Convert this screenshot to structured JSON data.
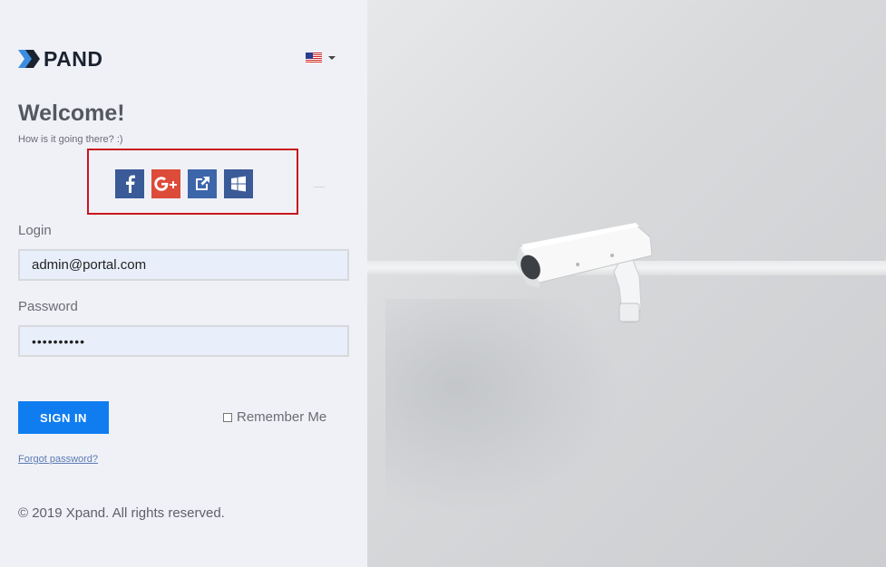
{
  "brand": {
    "logo_text": "PAND"
  },
  "language": {
    "selected": "en-US",
    "icon": "us-flag-icon"
  },
  "header": {
    "title": "Welcome!",
    "subtitle": "How is it going there? :)"
  },
  "social": [
    {
      "name": "facebook",
      "icon": "facebook-icon",
      "color": "#3b5a98"
    },
    {
      "name": "google-plus",
      "icon": "google-plus-icon",
      "color": "#dd4b39"
    },
    {
      "name": "external",
      "icon": "external-link-icon",
      "color": "#3d66aa"
    },
    {
      "name": "windows",
      "icon": "windows-icon",
      "color": "#3b5a98"
    }
  ],
  "form": {
    "login_label": "Login",
    "login_value": "admin@portal.com",
    "password_label": "Password",
    "password_value": "••••••••••",
    "signin_label": "SIGN IN",
    "remember_label": "Remember Me",
    "forgot_label": "Forgot password?"
  },
  "footer": {
    "copyright": "© 2019 Xpand. All rights reserved."
  },
  "colors": {
    "primary": "#0f7df0",
    "highlight_box": "#c8161c",
    "panel_bg": "#f0f1f7"
  }
}
